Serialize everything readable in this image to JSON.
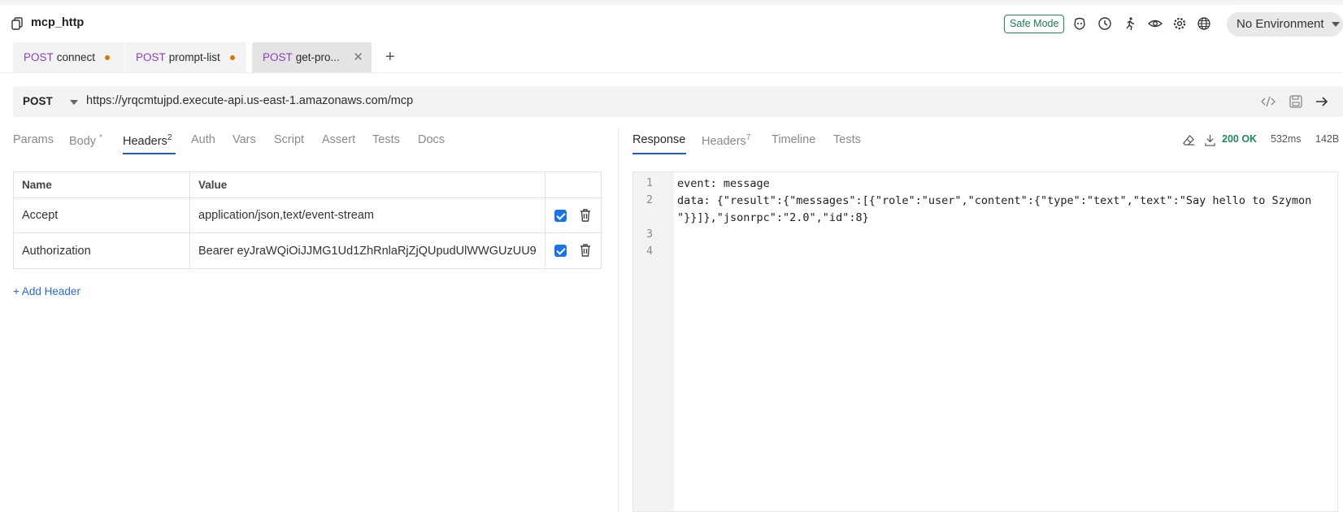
{
  "header": {
    "collection_name": "mcp_http",
    "safe_mode_label": "Safe Mode",
    "environment": "No Environment"
  },
  "tabs": [
    {
      "method": "POST",
      "name": "connect",
      "unsaved": true
    },
    {
      "method": "POST",
      "name": "prompt-list",
      "unsaved": true
    },
    {
      "method": "POST",
      "name": "get-pro...",
      "unsaved": false,
      "active": true
    }
  ],
  "request": {
    "method": "POST",
    "url": "https://yrqcmtujpd.execute-api.us-east-1.amazonaws.com/mcp"
  },
  "request_tabs": {
    "params": "Params",
    "body": "Body",
    "body_mark": "*",
    "headers": "Headers",
    "headers_count": "2",
    "auth": "Auth",
    "vars": "Vars",
    "script": "Script",
    "assert": "Assert",
    "tests": "Tests",
    "docs": "Docs"
  },
  "headers_table": {
    "col_name": "Name",
    "col_value": "Value",
    "rows": [
      {
        "name": "Accept",
        "value": "application/json,text/event-stream",
        "enabled": true
      },
      {
        "name": "Authorization",
        "value": "Bearer eyJraWQiOiJJMG1Ud1ZhRnlaRjZjQUpudUlWWGUzUU9",
        "enabled": true
      }
    ],
    "add_label": "+ Add Header"
  },
  "response_tabs": {
    "response": "Response",
    "headers": "Headers",
    "headers_count": "7",
    "timeline": "Timeline",
    "tests": "Tests"
  },
  "response_status": {
    "status": "200 OK",
    "time": "532ms",
    "size": "142B",
    "status_color": "#1d8a5e"
  },
  "response_body": {
    "line_numbers": [
      "1",
      "2",
      "3",
      "4"
    ],
    "line1": "event: message",
    "line2a": "data: {\"result\":{\"messages\":[{\"role\":\"user\",\"content\":{\"type\":\"text\",\"text\":\"Say hello to Szymon",
    "line2b": "\"}}]},\"jsonrpc\":\"2.0\",\"id\":8}"
  },
  "colors": {
    "method": "#8d3fbe",
    "accent": "#1f5fb8",
    "unsaved_dot": "#d97706"
  }
}
